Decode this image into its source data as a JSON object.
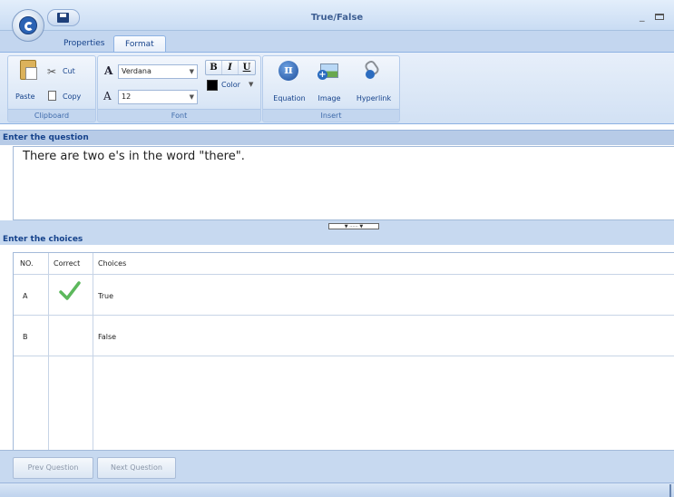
{
  "window": {
    "title": "True/False",
    "minimize_glyph": "_"
  },
  "tabs": [
    {
      "label": "Properties"
    },
    {
      "label": "Format"
    }
  ],
  "ribbon": {
    "clipboard": {
      "paste": "Paste",
      "cut": "Cut",
      "copy": "Copy",
      "group_label": "Clipboard"
    },
    "font": {
      "font_name": "Verdana",
      "font_glyph": "A",
      "size_glyph": "A",
      "font_size": "12",
      "bold": "B",
      "italic": "I",
      "underline": "U",
      "color": "Color",
      "group_label": "Font",
      "color_value": "#000000"
    },
    "insert": {
      "equation": "Equation",
      "image": "Image",
      "hyperlink": "Hyperlink",
      "group_label": "Insert"
    }
  },
  "question": {
    "header": "Enter the question",
    "text": "There are two e's in the word \"there\"."
  },
  "choices": {
    "header": "Enter the choices",
    "columns": {
      "no": "NO.",
      "correct": "Correct",
      "choices": "Choices"
    },
    "rows": [
      {
        "no": "A",
        "correct": true,
        "choice": "True"
      },
      {
        "no": "B",
        "correct": false,
        "choice": "False"
      }
    ]
  },
  "nav": {
    "prev": "Prev Question",
    "next": "Next Question"
  },
  "colors": {
    "accent": "#15428b",
    "panel": "#c7d9f0",
    "check": "#5cb85c"
  }
}
